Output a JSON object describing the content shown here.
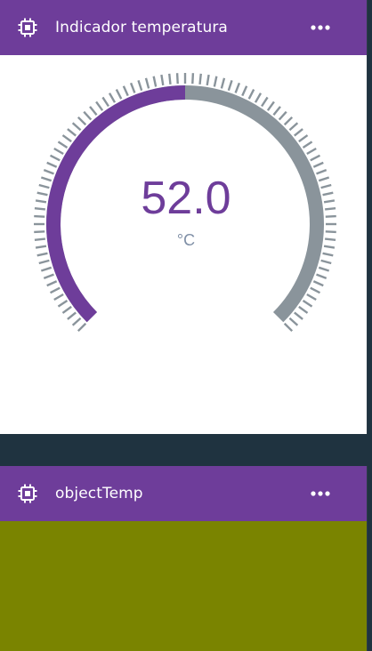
{
  "widgets": [
    {
      "title": "Indicador temperatura",
      "icon": "chip-icon",
      "menu_icon": "more-horizontal-icon",
      "gauge": {
        "value_text": "52.0",
        "unit": "°C",
        "fill_fraction": 0.5,
        "fill_color": "#6e3d9a",
        "track_color": "#8a949b"
      }
    },
    {
      "title": "objectTemp",
      "icon": "chip-icon",
      "menu_icon": "more-horizontal-icon",
      "background_color": "#7a8400"
    }
  ],
  "colors": {
    "header": "#6e3d9a",
    "page_background": "#1f3340"
  }
}
